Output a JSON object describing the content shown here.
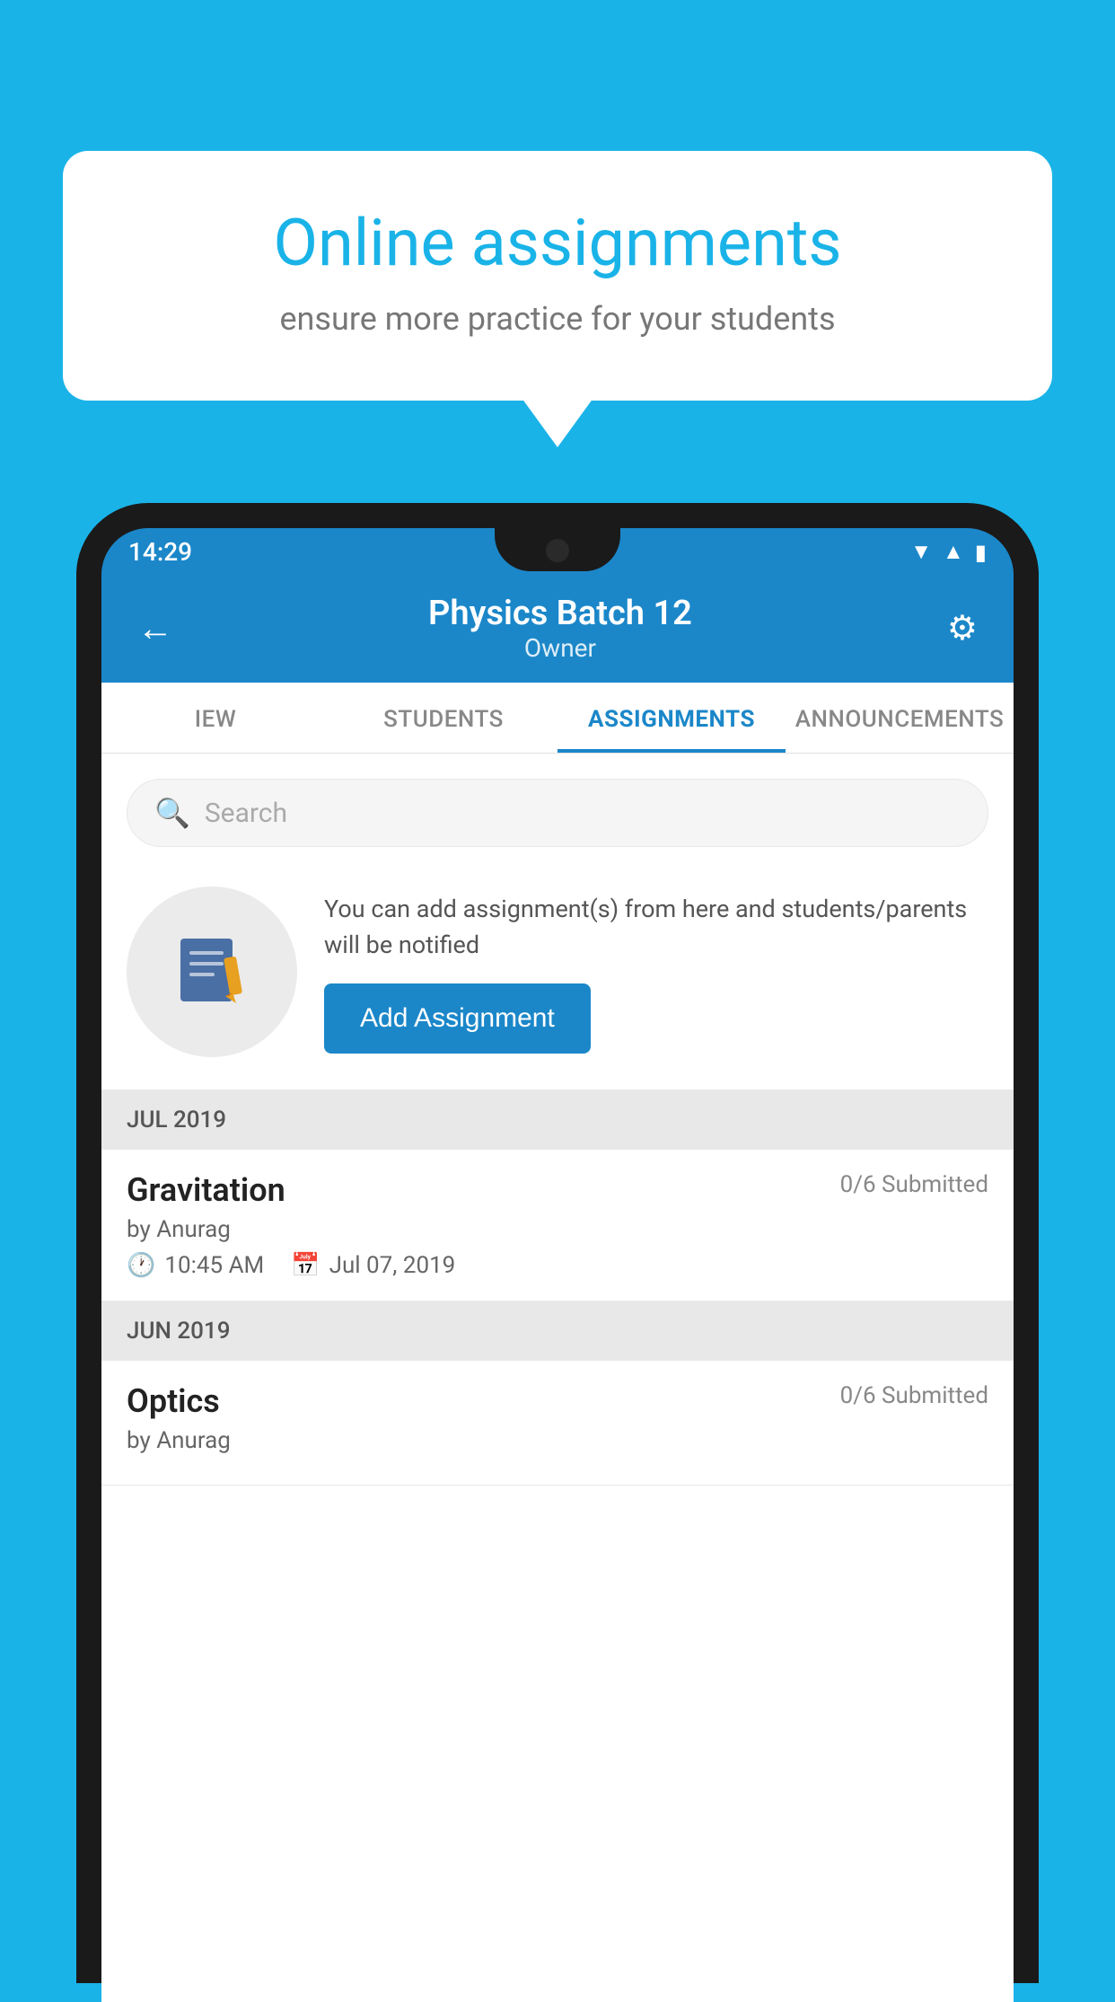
{
  "background": {
    "color": "#1ab3e8"
  },
  "speech_bubble": {
    "title": "Online assignments",
    "subtitle": "ensure more practice for your students"
  },
  "phone": {
    "status_bar": {
      "time": "14:29",
      "icons": [
        "wifi",
        "signal",
        "battery"
      ]
    },
    "header": {
      "title": "Physics Batch 12",
      "subtitle": "Owner",
      "back_label": "←",
      "settings_label": "⚙"
    },
    "tabs": [
      {
        "label": "IEW",
        "active": false
      },
      {
        "label": "STUDENTS",
        "active": false
      },
      {
        "label": "ASSIGNMENTS",
        "active": true
      },
      {
        "label": "ANNOUNCEMENTS",
        "active": false
      }
    ],
    "search": {
      "placeholder": "Search"
    },
    "promo": {
      "text": "You can add assignment(s) from here and students/parents will be notified",
      "button_label": "Add Assignment"
    },
    "sections": [
      {
        "label": "JUL 2019",
        "assignments": [
          {
            "name": "Gravitation",
            "submitted": "0/6 Submitted",
            "by": "by Anurag",
            "time": "10:45 AM",
            "date": "Jul 07, 2019"
          }
        ]
      },
      {
        "label": "JUN 2019",
        "assignments": [
          {
            "name": "Optics",
            "submitted": "0/6 Submitted",
            "by": "by Anurag",
            "time": "",
            "date": ""
          }
        ]
      }
    ]
  }
}
